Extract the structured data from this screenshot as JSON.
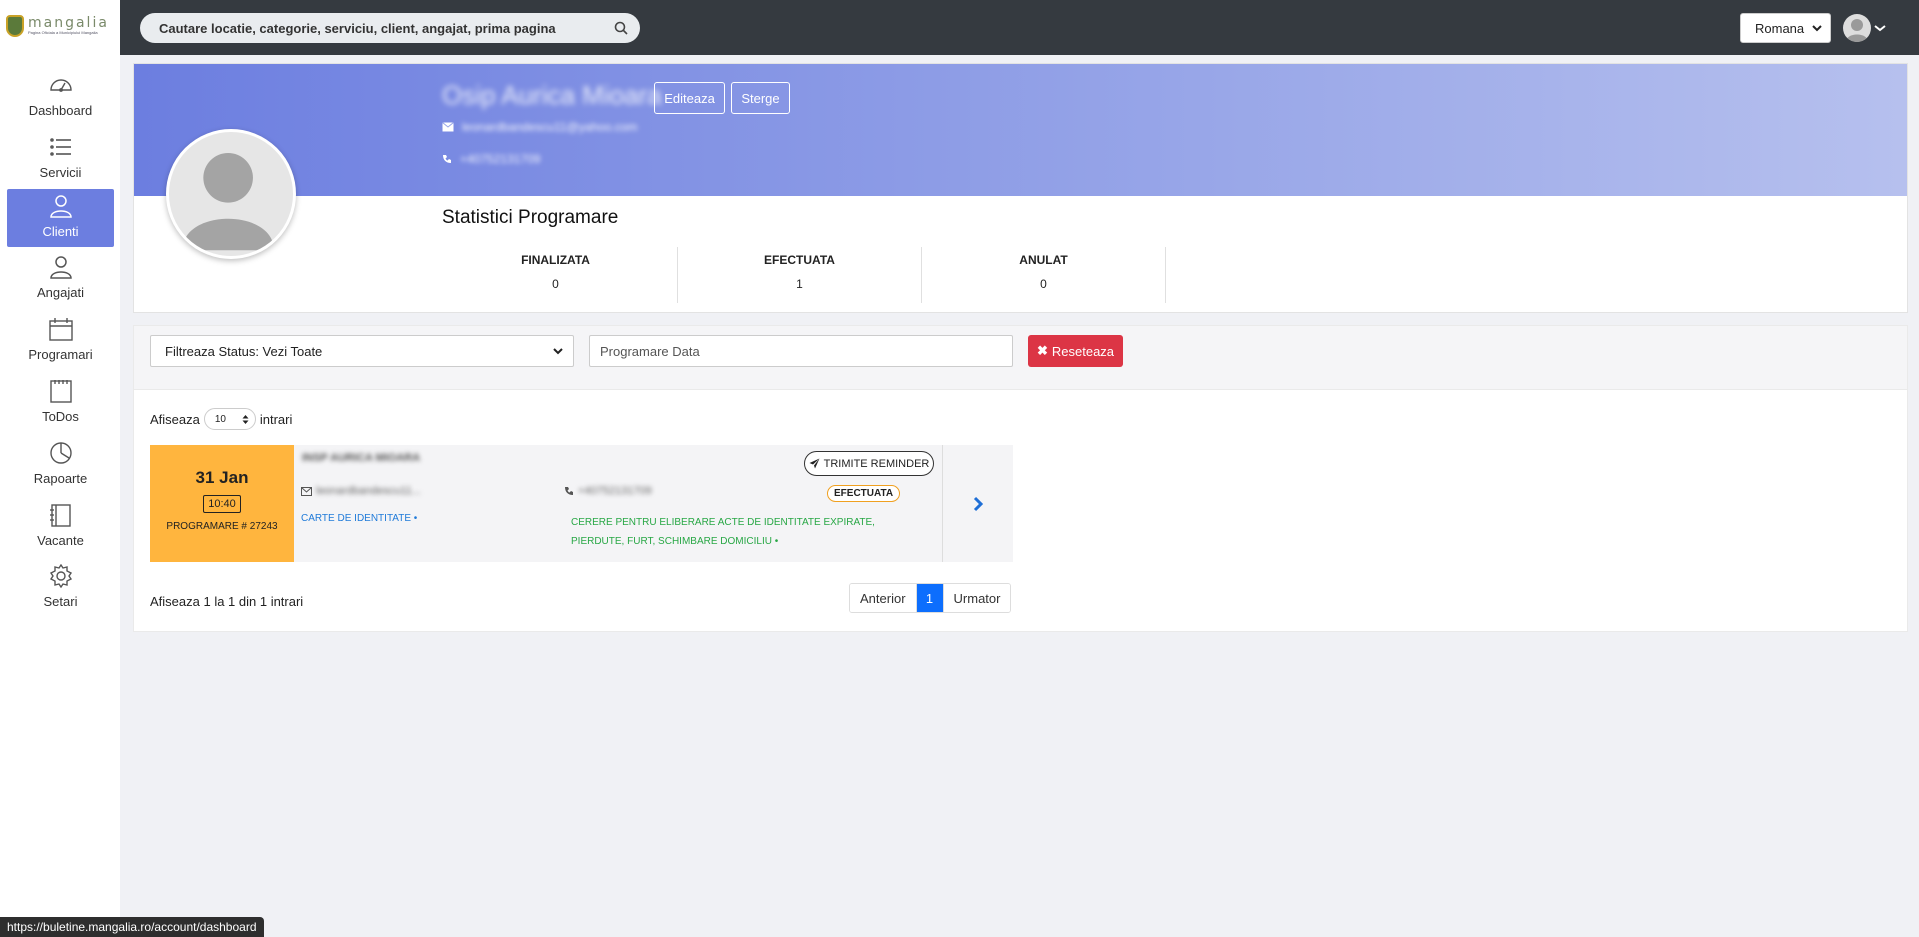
{
  "logo": {
    "name": "mangalia",
    "subtitle": "Pagina Oficiala a Municipiului Mangalia"
  },
  "sidebar": {
    "items": [
      {
        "label": "Dashboard",
        "icon": "dashboard-icon"
      },
      {
        "label": "Servicii",
        "icon": "list-icon"
      },
      {
        "label": "Clienti",
        "icon": "user-icon",
        "active": true
      },
      {
        "label": "Angajati",
        "icon": "user-icon"
      },
      {
        "label": "Programari",
        "icon": "calendar-icon"
      },
      {
        "label": "ToDos",
        "icon": "notepad-icon"
      },
      {
        "label": "Rapoarte",
        "icon": "pie-chart-icon"
      },
      {
        "label": "Vacante",
        "icon": "book-icon"
      },
      {
        "label": "Setari",
        "icon": "gear-icon"
      }
    ]
  },
  "topbar": {
    "search_placeholder": "Cautare locatie, categorie, serviciu, client, angajat, prima pagina",
    "language": "Romana"
  },
  "profile": {
    "name": "Osip Aurica Mioara",
    "email": "leonardbandescu11@yahoo.com",
    "phone": "+40752131709",
    "edit_label": "Editeaza",
    "delete_label": "Sterge",
    "stats_title": "Statistici Programare",
    "stats": [
      {
        "label": "FINALIZATA",
        "value": "0"
      },
      {
        "label": "EFECTUATA",
        "value": "1"
      },
      {
        "label": "ANULAT",
        "value": "0"
      }
    ]
  },
  "filters": {
    "status_select": "Filtreaza Status: Vezi Toate",
    "date_placeholder": "Programare Data",
    "reset_label": "Reseteaza"
  },
  "list": {
    "show_label": "Afiseaza",
    "entries_value": "10",
    "entries_suffix": "intrari",
    "appointments": [
      {
        "day": "31 Jan",
        "time": "10:40",
        "number": "PROGRAMARE # 27243",
        "client_name": "INSP AURICA MIOARA",
        "email": "leonardbandescu11...",
        "phone": "+40752131709",
        "reminder_label": "TRIMITE REMINDER",
        "status": "EFECTUATA",
        "service": "CARTE DE IDENTITATE •",
        "description": "CERERE PENTRU ELIBERARE ACTE DE IDENTITATE EXPIRATE, PIERDUTE, FURT, SCHIMBARE DOMICILIU •"
      }
    ],
    "info": "Afiseaza 1 la 1 din 1 intrari",
    "pagination": {
      "prev": "Anterior",
      "current": "1",
      "next": "Urmator"
    }
  },
  "status_url": "https://buletine.mangalia.ro/account/dashboard",
  "colors": {
    "accent": "#6c7ee0",
    "danger": "#dc3545",
    "date_block": "#ffb53e",
    "page_active": "#0d6efd",
    "topbar": "#353a40"
  }
}
